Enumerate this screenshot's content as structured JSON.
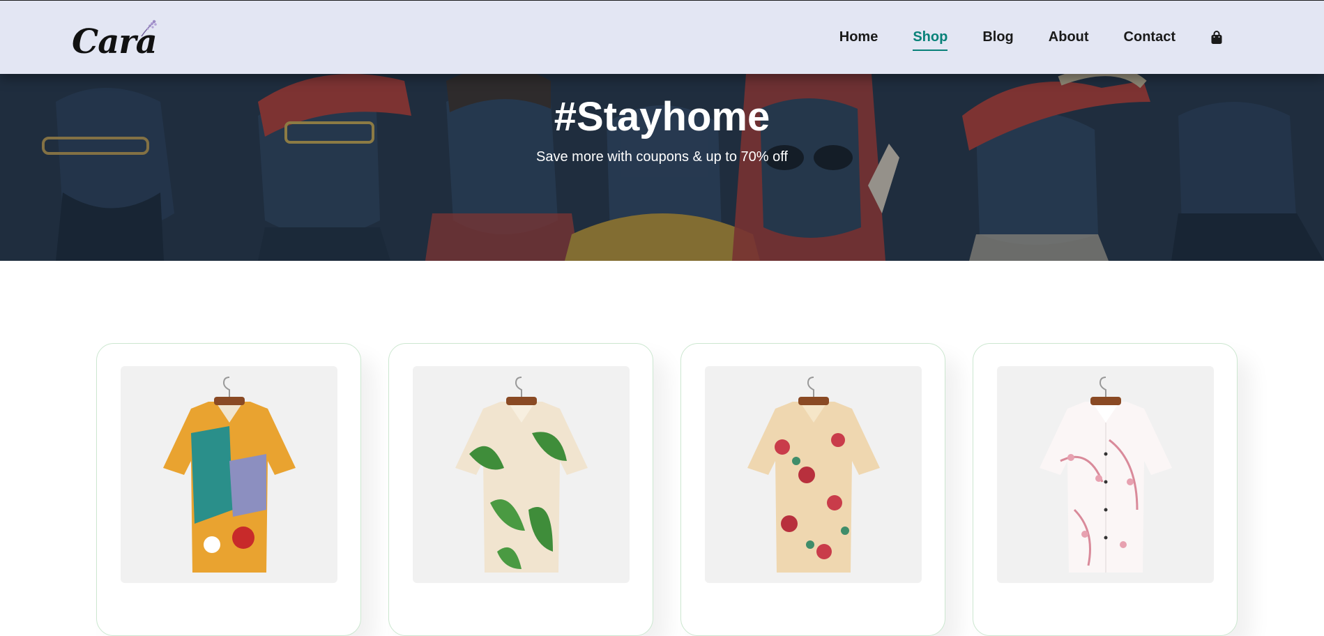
{
  "brand": {
    "logo_text": "Cara"
  },
  "nav": {
    "items": [
      {
        "label": "Home",
        "active": false
      },
      {
        "label": "Shop",
        "active": true
      },
      {
        "label": "Blog",
        "active": false
      },
      {
        "label": "About",
        "active": false
      },
      {
        "label": "Contact",
        "active": false
      }
    ],
    "cart_icon": "shopping-bag-icon"
  },
  "hero": {
    "title": "#Stayhome",
    "subtitle": "Save more with coupons & up to 70% off"
  },
  "products": [
    {
      "image": "colorful-abstract-print-shirt"
    },
    {
      "image": "green-leaf-floral-print-shirt"
    },
    {
      "image": "red-floral-cream-shirt"
    },
    {
      "image": "pink-blossom-white-shirt"
    }
  ],
  "colors": {
    "header_bg": "#e3e6f3",
    "accent": "#088178",
    "hero_bg": "#1f2d3e"
  }
}
